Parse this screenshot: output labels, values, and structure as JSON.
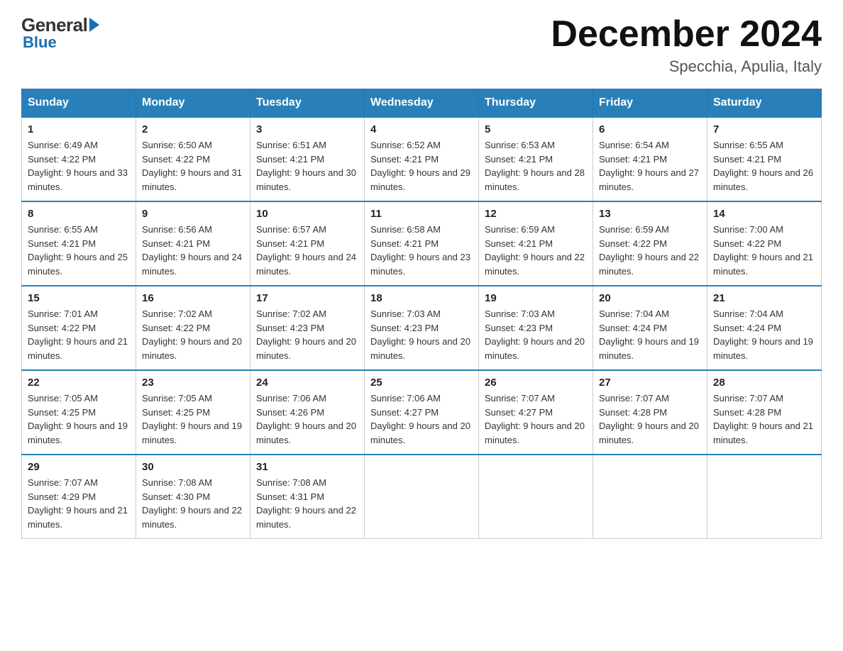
{
  "header": {
    "logo_general": "General",
    "logo_blue": "Blue",
    "title": "December 2024",
    "location": "Specchia, Apulia, Italy"
  },
  "days_of_week": [
    "Sunday",
    "Monday",
    "Tuesday",
    "Wednesday",
    "Thursday",
    "Friday",
    "Saturday"
  ],
  "weeks": [
    [
      {
        "day": "1",
        "sunrise": "6:49 AM",
        "sunset": "4:22 PM",
        "daylight": "9 hours and 33 minutes."
      },
      {
        "day": "2",
        "sunrise": "6:50 AM",
        "sunset": "4:22 PM",
        "daylight": "9 hours and 31 minutes."
      },
      {
        "day": "3",
        "sunrise": "6:51 AM",
        "sunset": "4:21 PM",
        "daylight": "9 hours and 30 minutes."
      },
      {
        "day": "4",
        "sunrise": "6:52 AM",
        "sunset": "4:21 PM",
        "daylight": "9 hours and 29 minutes."
      },
      {
        "day": "5",
        "sunrise": "6:53 AM",
        "sunset": "4:21 PM",
        "daylight": "9 hours and 28 minutes."
      },
      {
        "day": "6",
        "sunrise": "6:54 AM",
        "sunset": "4:21 PM",
        "daylight": "9 hours and 27 minutes."
      },
      {
        "day": "7",
        "sunrise": "6:55 AM",
        "sunset": "4:21 PM",
        "daylight": "9 hours and 26 minutes."
      }
    ],
    [
      {
        "day": "8",
        "sunrise": "6:55 AM",
        "sunset": "4:21 PM",
        "daylight": "9 hours and 25 minutes."
      },
      {
        "day": "9",
        "sunrise": "6:56 AM",
        "sunset": "4:21 PM",
        "daylight": "9 hours and 24 minutes."
      },
      {
        "day": "10",
        "sunrise": "6:57 AM",
        "sunset": "4:21 PM",
        "daylight": "9 hours and 24 minutes."
      },
      {
        "day": "11",
        "sunrise": "6:58 AM",
        "sunset": "4:21 PM",
        "daylight": "9 hours and 23 minutes."
      },
      {
        "day": "12",
        "sunrise": "6:59 AM",
        "sunset": "4:21 PM",
        "daylight": "9 hours and 22 minutes."
      },
      {
        "day": "13",
        "sunrise": "6:59 AM",
        "sunset": "4:22 PM",
        "daylight": "9 hours and 22 minutes."
      },
      {
        "day": "14",
        "sunrise": "7:00 AM",
        "sunset": "4:22 PM",
        "daylight": "9 hours and 21 minutes."
      }
    ],
    [
      {
        "day": "15",
        "sunrise": "7:01 AM",
        "sunset": "4:22 PM",
        "daylight": "9 hours and 21 minutes."
      },
      {
        "day": "16",
        "sunrise": "7:02 AM",
        "sunset": "4:22 PM",
        "daylight": "9 hours and 20 minutes."
      },
      {
        "day": "17",
        "sunrise": "7:02 AM",
        "sunset": "4:23 PM",
        "daylight": "9 hours and 20 minutes."
      },
      {
        "day": "18",
        "sunrise": "7:03 AM",
        "sunset": "4:23 PM",
        "daylight": "9 hours and 20 minutes."
      },
      {
        "day": "19",
        "sunrise": "7:03 AM",
        "sunset": "4:23 PM",
        "daylight": "9 hours and 20 minutes."
      },
      {
        "day": "20",
        "sunrise": "7:04 AM",
        "sunset": "4:24 PM",
        "daylight": "9 hours and 19 minutes."
      },
      {
        "day": "21",
        "sunrise": "7:04 AM",
        "sunset": "4:24 PM",
        "daylight": "9 hours and 19 minutes."
      }
    ],
    [
      {
        "day": "22",
        "sunrise": "7:05 AM",
        "sunset": "4:25 PM",
        "daylight": "9 hours and 19 minutes."
      },
      {
        "day": "23",
        "sunrise": "7:05 AM",
        "sunset": "4:25 PM",
        "daylight": "9 hours and 19 minutes."
      },
      {
        "day": "24",
        "sunrise": "7:06 AM",
        "sunset": "4:26 PM",
        "daylight": "9 hours and 20 minutes."
      },
      {
        "day": "25",
        "sunrise": "7:06 AM",
        "sunset": "4:27 PM",
        "daylight": "9 hours and 20 minutes."
      },
      {
        "day": "26",
        "sunrise": "7:07 AM",
        "sunset": "4:27 PM",
        "daylight": "9 hours and 20 minutes."
      },
      {
        "day": "27",
        "sunrise": "7:07 AM",
        "sunset": "4:28 PM",
        "daylight": "9 hours and 20 minutes."
      },
      {
        "day": "28",
        "sunrise": "7:07 AM",
        "sunset": "4:28 PM",
        "daylight": "9 hours and 21 minutes."
      }
    ],
    [
      {
        "day": "29",
        "sunrise": "7:07 AM",
        "sunset": "4:29 PM",
        "daylight": "9 hours and 21 minutes."
      },
      {
        "day": "30",
        "sunrise": "7:08 AM",
        "sunset": "4:30 PM",
        "daylight": "9 hours and 22 minutes."
      },
      {
        "day": "31",
        "sunrise": "7:08 AM",
        "sunset": "4:31 PM",
        "daylight": "9 hours and 22 minutes."
      },
      null,
      null,
      null,
      null
    ]
  ]
}
